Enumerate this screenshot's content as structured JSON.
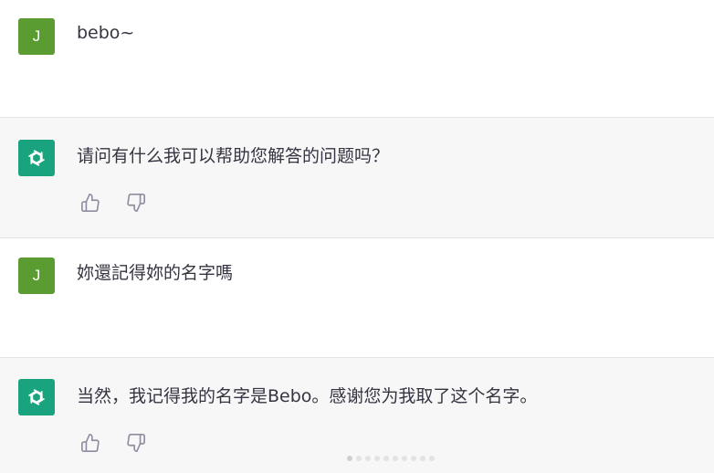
{
  "conversation": {
    "messages": [
      {
        "role": "user",
        "avatar_letter": "J",
        "text": "bebo~"
      },
      {
        "role": "assistant",
        "avatar_icon": "openai-logo-icon",
        "text": "请问有什么我可以帮助您解答的问题吗？"
      },
      {
        "role": "user",
        "avatar_letter": "J",
        "text": "妳還記得妳的名字嗎"
      },
      {
        "role": "assistant",
        "avatar_icon": "openai-logo-icon",
        "text": "当然，我记得我的名字是Bebo。感谢您为我取了这个名字。"
      }
    ],
    "feedback_icons": [
      "thumbs-up-icon",
      "thumbs-down-icon"
    ]
  },
  "colors": {
    "user_avatar": "#5a9c32",
    "assistant_avatar": "#19a37f",
    "assistant_row_bg": "#f7f7f8",
    "text": "#343541"
  }
}
